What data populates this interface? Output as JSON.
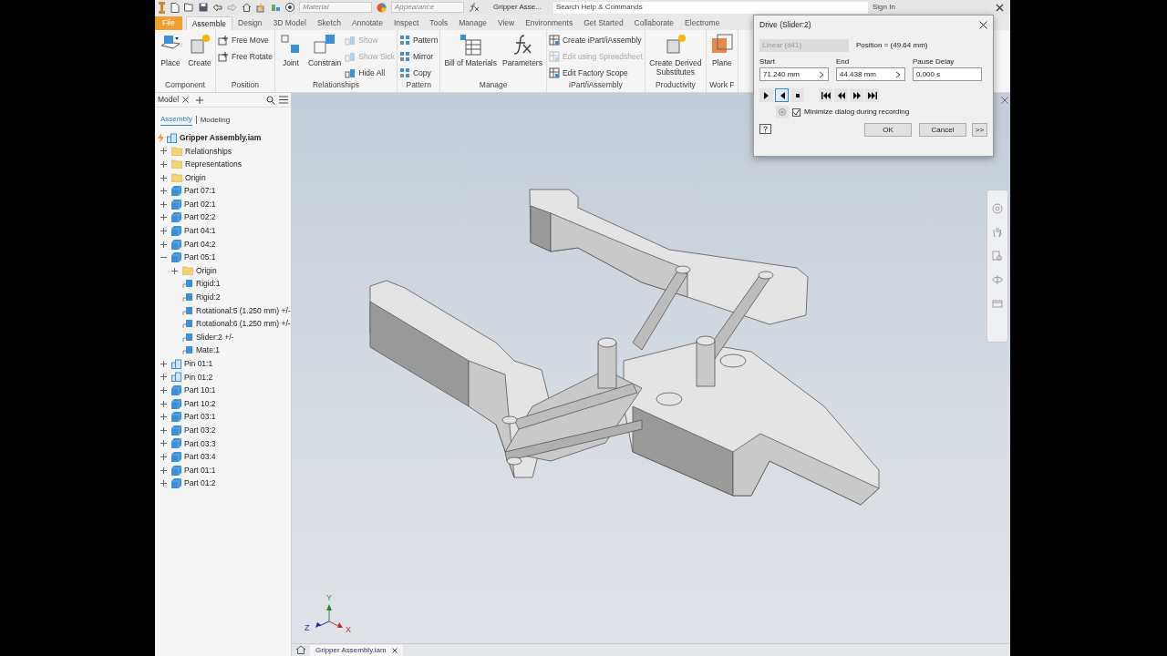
{
  "quick_access": {
    "material": "Material",
    "appearance": "Appearance",
    "document_title": "Gripper Asse...",
    "search_placeholder": "Search Help & Commands",
    "sign_in": "Sign In"
  },
  "tabs": [
    {
      "label": "File",
      "kind": "file",
      "selected": false
    },
    {
      "label": "Assemble",
      "kind": "tab",
      "selected": true
    },
    {
      "label": "Design",
      "kind": "tab",
      "selected": false
    },
    {
      "label": "3D Model",
      "kind": "tab",
      "selected": false
    },
    {
      "label": "Sketch",
      "kind": "tab",
      "selected": false
    },
    {
      "label": "Annotate",
      "kind": "tab",
      "selected": false
    },
    {
      "label": "Inspect",
      "kind": "tab",
      "selected": false
    },
    {
      "label": "Tools",
      "kind": "tab",
      "selected": false
    },
    {
      "label": "Manage",
      "kind": "tab",
      "selected": false
    },
    {
      "label": "View",
      "kind": "tab",
      "selected": false
    },
    {
      "label": "Environments",
      "kind": "tab",
      "selected": false
    },
    {
      "label": "Get Started",
      "kind": "tab",
      "selected": false
    },
    {
      "label": "Collaborate",
      "kind": "tab",
      "selected": false
    },
    {
      "label": "Electrome",
      "kind": "tab",
      "selected": false
    }
  ],
  "ribbon": [
    {
      "title": "Component",
      "buttons": [
        {
          "label": "Place",
          "kind": "large",
          "disabled": false
        },
        {
          "label": "Create",
          "kind": "large",
          "disabled": false
        }
      ]
    },
    {
      "title": "Position",
      "buttons": [
        {
          "label": "Free Move",
          "kind": "small",
          "disabled": false
        },
        {
          "label": "Free Rotate",
          "kind": "small",
          "disabled": false
        }
      ]
    },
    {
      "title": "Relationships",
      "buttons": [
        {
          "label": "Joint",
          "kind": "large",
          "disabled": false
        },
        {
          "label": "Constrain",
          "kind": "large",
          "disabled": false
        },
        {
          "label": "Show",
          "kind": "small",
          "disabled": true
        },
        {
          "label": "Show Sick",
          "kind": "small",
          "disabled": true
        },
        {
          "label": "Hide All",
          "kind": "small",
          "disabled": false
        }
      ]
    },
    {
      "title": "Pattern",
      "buttons": [
        {
          "label": "Pattern",
          "kind": "small",
          "disabled": false
        },
        {
          "label": "Mirror",
          "kind": "small",
          "disabled": false
        },
        {
          "label": "Copy",
          "kind": "small",
          "disabled": false
        }
      ]
    },
    {
      "title": "Manage",
      "buttons": [
        {
          "label": "Bill of Materials",
          "kind": "large",
          "disabled": false
        },
        {
          "label": "Parameters",
          "kind": "large",
          "disabled": false
        }
      ]
    },
    {
      "title": "iPart/iAssembly",
      "buttons": [
        {
          "label": "Create iPart/iAssembly",
          "kind": "small",
          "disabled": false
        },
        {
          "label": "Edit using Spreadsheet",
          "kind": "small",
          "disabled": true
        },
        {
          "label": "Edit Factory Scope",
          "kind": "small",
          "disabled": false
        }
      ]
    },
    {
      "title": "Productivity",
      "buttons": [
        {
          "label": "Create Derived Substitutes",
          "kind": "large",
          "disabled": false
        }
      ]
    },
    {
      "title": "Work F",
      "buttons": [
        {
          "label": "Plane",
          "kind": "large",
          "disabled": false
        }
      ]
    }
  ],
  "browser": {
    "tab": "Model",
    "subtabs": [
      {
        "label": "Assembly",
        "selected": true
      },
      {
        "label": "Modeling",
        "selected": false
      }
    ],
    "tree": [
      {
        "label": "Gripper Assembly.iam",
        "kind": "assembly",
        "children": [
          {
            "label": "Relationships",
            "kind": "folder",
            "expanded": false
          },
          {
            "label": "Representations",
            "kind": "folder",
            "expanded": false
          },
          {
            "label": "Origin",
            "kind": "folder",
            "expanded": false
          },
          {
            "label": "Part 07:1",
            "kind": "part",
            "expanded": false
          },
          {
            "label": "Part 02:1",
            "kind": "part",
            "expanded": false
          },
          {
            "label": "Part 02:2",
            "kind": "part",
            "expanded": false
          },
          {
            "label": "Part 04:1",
            "kind": "part",
            "expanded": false
          },
          {
            "label": "Part 04:2",
            "kind": "part",
            "expanded": false
          },
          {
            "label": "Part 05:1",
            "kind": "part",
            "expanded": true,
            "children": [
              {
                "label": "Origin",
                "kind": "folder",
                "expanded": false
              },
              {
                "label": "Rigid:1",
                "kind": "joint"
              },
              {
                "label": "Rigid:2",
                "kind": "joint"
              },
              {
                "label": "Rotational:5 (1.250 mm) +/-",
                "kind": "joint"
              },
              {
                "label": "Rotational:6 (1.250 mm) +/-",
                "kind": "joint"
              },
              {
                "label": "Slider:2 +/-",
                "kind": "joint"
              },
              {
                "label": "Mate:1",
                "kind": "joint"
              }
            ]
          },
          {
            "label": "Pin 01:1",
            "kind": "assembly",
            "expanded": false
          },
          {
            "label": "Pin 01:2",
            "kind": "assembly",
            "expanded": false
          },
          {
            "label": "Part 10:1",
            "kind": "part",
            "expanded": false
          },
          {
            "label": "Part 10:2",
            "kind": "part",
            "expanded": false
          },
          {
            "label": "Part 03:1",
            "kind": "part",
            "expanded": false
          },
          {
            "label": "Part 03:2",
            "kind": "part",
            "expanded": false
          },
          {
            "label": "Part 03:3",
            "kind": "part",
            "expanded": false
          },
          {
            "label": "Part 03:4",
            "kind": "part",
            "expanded": false
          },
          {
            "label": "Part 01:1",
            "kind": "part",
            "expanded": false
          },
          {
            "label": "Part 01:2",
            "kind": "part",
            "expanded": false
          }
        ]
      }
    ]
  },
  "triad": {
    "x": "X",
    "y": "Y",
    "z": "Z"
  },
  "document_tab": {
    "label": "Gripper Assembly.iam",
    "selected": true
  },
  "dialog": {
    "title": "Drive (Slider:2)",
    "type": {
      "value": "Linear (d41)",
      "disabled": true
    },
    "position": "Position = (49.64 mm)",
    "fields": [
      {
        "label": "Start",
        "value": "71.240 mm",
        "kind": "measure"
      },
      {
        "label": "End",
        "value": "44.438 mm",
        "kind": "measure"
      },
      {
        "label": "Pause Delay",
        "value": "0.000 s",
        "kind": "plain"
      }
    ],
    "playback": [
      {
        "kind": "forward",
        "selected": false
      },
      {
        "kind": "reverse",
        "selected": true
      },
      {
        "kind": "stop",
        "selected": false
      },
      {
        "kind": "to-start",
        "selected": false
      },
      {
        "kind": "step-back",
        "selected": false
      },
      {
        "kind": "step-forward",
        "selected": false
      },
      {
        "kind": "to-end",
        "selected": false
      }
    ],
    "minimize": {
      "label": "Minimize dialog during recording",
      "checked": true
    },
    "buttons": [
      "OK",
      "Cancel",
      ">>"
    ]
  }
}
